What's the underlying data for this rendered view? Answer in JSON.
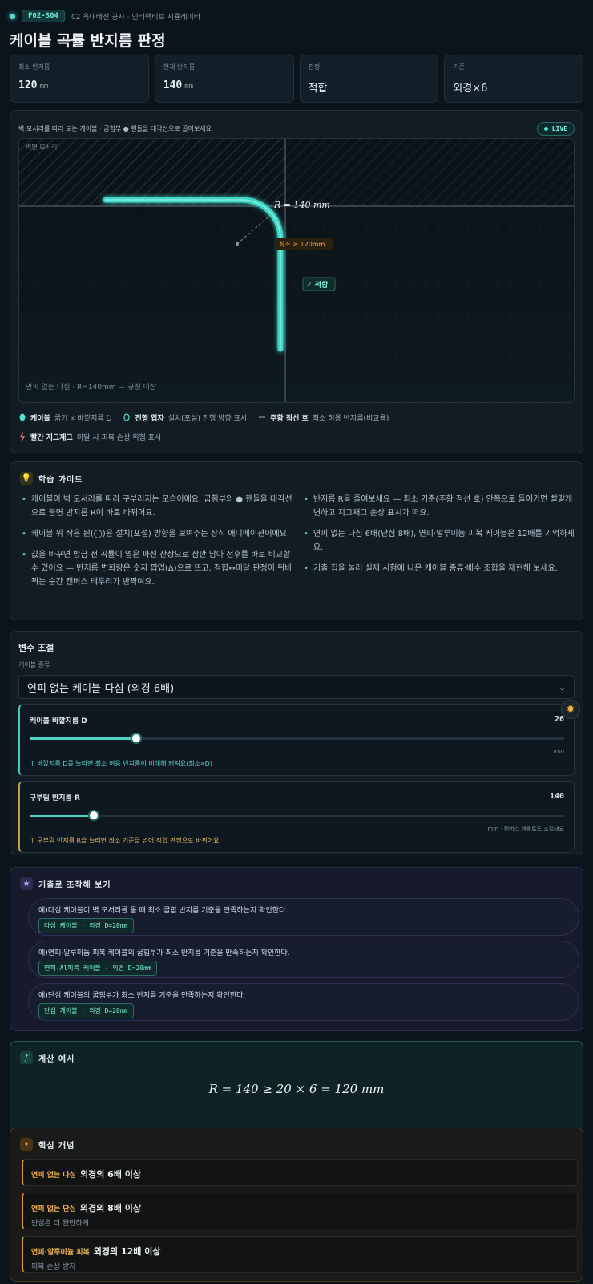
{
  "header": {
    "code": "F02-S04",
    "crumb": "02 옥내배선 공사 · 인터랙티브 시뮬레이터",
    "title": "케이블 곡률 반지름 판정"
  },
  "stats": [
    {
      "label": "최소 반지름",
      "value": "120",
      "unit": "mm"
    },
    {
      "label": "현재 반지름",
      "value": "140",
      "unit": "mm"
    },
    {
      "label": "판정",
      "value": "적합",
      "unit": ""
    },
    {
      "label": "기준",
      "value": "외경×6",
      "unit": ""
    }
  ],
  "sim": {
    "instruction": "벽 모서리를 따라 도는 케이블 · 굽힘부 ● 핸들을 대각선으로 끌어보세요",
    "live": "LIVE",
    "wall_label": "벽면 모서리",
    "radius_label": "R = 140 mm",
    "min_label": "최소 ≥ 120mm",
    "ok_badge": "✓ 적합",
    "footer_note": "연피 없는 다심 · R=140mm — 규정 이상",
    "bend_radius_mm": 140,
    "min_radius_mm": 120
  },
  "legend": [
    {
      "icon": "cable-dot-icon",
      "key": "케이블",
      "desc": "굵기 ∝ 바깥지름 D"
    },
    {
      "icon": "ring-icon",
      "key": "진행 입자",
      "desc": "설치(포설) 진행 방향 표시"
    },
    {
      "icon": "dash-icon",
      "key": "주황 점선 호",
      "desc": "최소 허용 반지름(비교용)"
    },
    {
      "icon": "zigzag-icon",
      "key": "빨간 지그재그",
      "desc": "미달 시 피복 손상 위험 표시"
    }
  ],
  "guide": {
    "title": "학습 가이드",
    "left": [
      "케이블이 벽 모서리를 따라 구부러지는 모습이에요. 굽힘부의 ● 핸들을 대각선으로 끌면 반지름 R이 바로 바뀌어요.",
      "케이블 위 작은 원(◯)은 설치(포설) 방향을 보여주는 장식 애니메이션이에요.",
      "값을 바꾸면 방금 전 곡률이 옅은 파선 잔상으로 잠깐 남아 전후를 바로 비교할 수 있어요 — 반지름 변화량은 숫자 팝업(Δ)으로 뜨고, 적합↔미달 판정이 뒤바뀌는 순간 캔버스 테두리가 반짝여요."
    ],
    "right": [
      "반지름 R을 줄여보세요 — 최소 기준(주황 점선 호) 안쪽으로 들어가면 빨갛게 변하고 지그재그 손상 표시가 떠요.",
      "연피 없는 다심 6배(단심 8배), 연피·알루미늄 피복 케이블은 12배를 기억하세요.",
      "기출 칩을 눌러 실제 시험에 나온 케이블 종류·배수 조합을 재현해 보세요."
    ]
  },
  "vars": {
    "title": "변수 조절",
    "type_label": "케이블 종류",
    "type_value": "연피 없는 케이블-다심 (외경 6배)",
    "sliders": [
      {
        "label": "케이블 바깥지름 D",
        "value": "26",
        "fraction": 0.2,
        "unit": "mm",
        "hint": "↑ 바깥지름 D를 늘리면 최소 허용 반지름이 비례해 커져요(최소∝D)"
      },
      {
        "label": "구부림 반지름 R",
        "value": "140",
        "fraction": 0.12,
        "unit": "mm · 캔버스 핸들로도 조절돼요",
        "hint": "↑ 구부림 반지름 R을 늘리면 최소 기준을 넘어 적합 판정으로 바뀌어요"
      }
    ]
  },
  "exam": {
    "title": "기출로 조작해 보기",
    "items": [
      {
        "text": "예)다심 케이블이 벽 모서리를 돌 때 최소 굽힘 반지름 기준을 만족하는지 확인한다.",
        "chip": "다심 케이블 · 외경 D=20mm"
      },
      {
        "text": "예)연피·알루미늄 피복 케이블의 굽힘부가 최소 반지름 기준을 만족하는지 확인한다.",
        "chip": "연피·Al피복 케이블 · 외경 D=20mm"
      },
      {
        "text": "예)단심 케이블의 굽힘부가 최소 반지름 기준을 만족하는지 확인한다.",
        "chip": "단심 케이블 · 외경 D=20mm"
      }
    ]
  },
  "calc": {
    "title": "계산 예시",
    "formula": "R = 140 ≥ 20 × 6 = 120 mm"
  },
  "concept": {
    "title": "핵심 개념",
    "items": [
      {
        "key": "연피 없는 다심",
        "value": "외경의 6배 이상",
        "sub": ""
      },
      {
        "key": "연피 없는 단심",
        "value": "외경의 8배 이상",
        "sub": "단심은 더 완만하게"
      },
      {
        "key": "연피·알루미늄 피복",
        "value": "외경의 12배 이상",
        "sub": "피복 손상 방지"
      }
    ]
  },
  "colors": {
    "accent": "#4fe0cf",
    "warn": "#e1b45f",
    "ok": "#7ff0df"
  }
}
